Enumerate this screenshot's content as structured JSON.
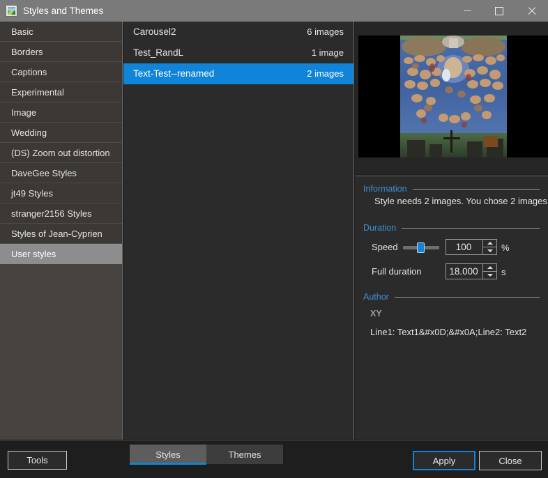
{
  "window": {
    "title": "Styles and Themes",
    "icon": "picture-icon",
    "controls": {
      "minimize": "minimize-icon",
      "maximize": "maximize-icon",
      "close": "close-icon"
    }
  },
  "sidebar": {
    "items": [
      {
        "label": "Basic",
        "selected": false
      },
      {
        "label": "Borders",
        "selected": false
      },
      {
        "label": "Captions",
        "selected": false
      },
      {
        "label": "Experimental",
        "selected": false
      },
      {
        "label": "Image",
        "selected": false
      },
      {
        "label": "Wedding",
        "selected": false
      },
      {
        "label": "(DS) Zoom out distortion",
        "selected": false
      },
      {
        "label": "DaveGee Styles",
        "selected": false
      },
      {
        "label": "jt49 Styles",
        "selected": false
      },
      {
        "label": "stranger2156 Styles",
        "selected": false
      },
      {
        "label": "Styles of Jean-Cyprien",
        "selected": false
      },
      {
        "label": "User styles",
        "selected": true
      }
    ]
  },
  "style_list": {
    "rows": [
      {
        "name": "Carousel2",
        "count": "6 images",
        "selected": false
      },
      {
        "name": "Test_RandL",
        "count": "1 image",
        "selected": false
      },
      {
        "name": "Text-Test--renamed",
        "count": "2 images",
        "selected": true
      }
    ]
  },
  "preview": {
    "alt": "Michelangelo The Last Judgment fresco preview"
  },
  "details": {
    "information": {
      "title": "Information",
      "text": "Style needs 2 images. You chose 2 images"
    },
    "duration": {
      "title": "Duration",
      "speed_label": "Speed",
      "speed_value": "100",
      "speed_unit": "%",
      "full_duration_label": "Full duration",
      "full_duration_value": "18.000",
      "full_duration_unit": "s"
    },
    "author": {
      "title": "Author",
      "name": "XY",
      "description": "Line1: Text1&#x0D;&#x0A;Line2: Text2"
    }
  },
  "footer": {
    "tools_label": "Tools",
    "tabs": [
      {
        "label": "Styles",
        "active": true
      },
      {
        "label": "Themes",
        "active": false
      }
    ],
    "apply_label": "Apply",
    "close_label": "Close"
  },
  "colors": {
    "titlebar": "#7a7a7a",
    "accent": "#0f84d8",
    "section_header": "#3f8fd8",
    "sidebar_selected": "#8d8d8d",
    "panel_bg": "#2b2b2b"
  }
}
